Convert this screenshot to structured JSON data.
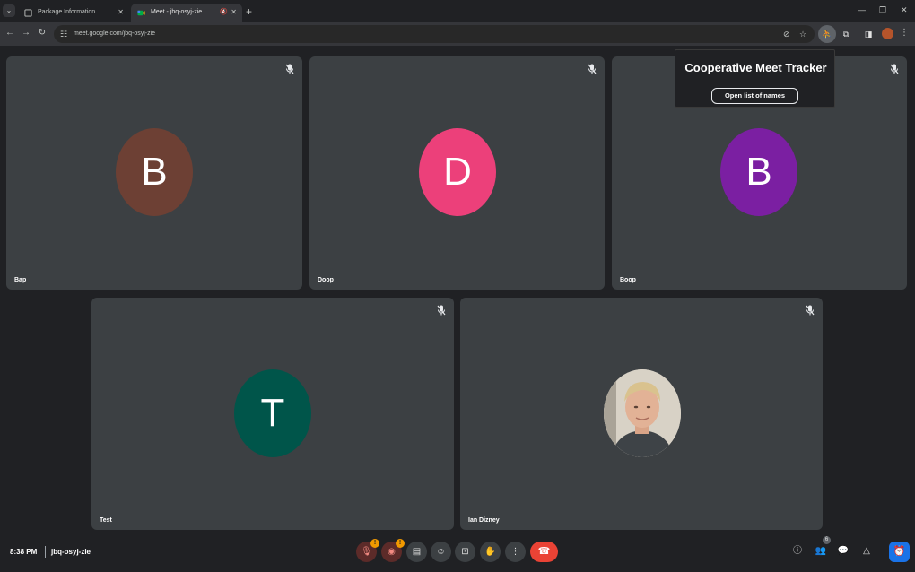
{
  "browser": {
    "tabs": [
      {
        "title": "Package Information",
        "active": false
      },
      {
        "title": "Meet - jbq-osyj-zie",
        "active": true
      }
    ],
    "url": "meet.google.com/jbq-osyj-zie"
  },
  "extension_popup": {
    "title": "Cooperative Meet Tracker",
    "button_label": "Open list of names"
  },
  "participants": [
    {
      "name": "Bap",
      "initial": "B",
      "color": "#6d4034"
    },
    {
      "name": "Doop",
      "initial": "D",
      "color": "#ec407a"
    },
    {
      "name": "Boop",
      "initial": "B",
      "color": "#7b1fa2"
    },
    {
      "name": "Test",
      "initial": "T",
      "color": "#00554a"
    },
    {
      "name": "Ian Dizney",
      "initial": "",
      "color": "#c9c3b8"
    }
  ],
  "meeting": {
    "time": "8:38 PM",
    "code": "jbq-osyj-zie",
    "people_count": "6"
  },
  "icons": {
    "mic_off": "mic-off-icon",
    "camera_off": "camera-off-icon",
    "captions": "captions-icon",
    "emoji": "emoji-icon",
    "present": "present-icon",
    "raise_hand": "raise-hand-icon",
    "more": "more-options-icon",
    "end_call": "end-call-icon",
    "info": "info-icon",
    "people": "people-icon",
    "chat": "chat-icon",
    "activities": "activities-icon",
    "host_controls": "host-controls-icon"
  }
}
